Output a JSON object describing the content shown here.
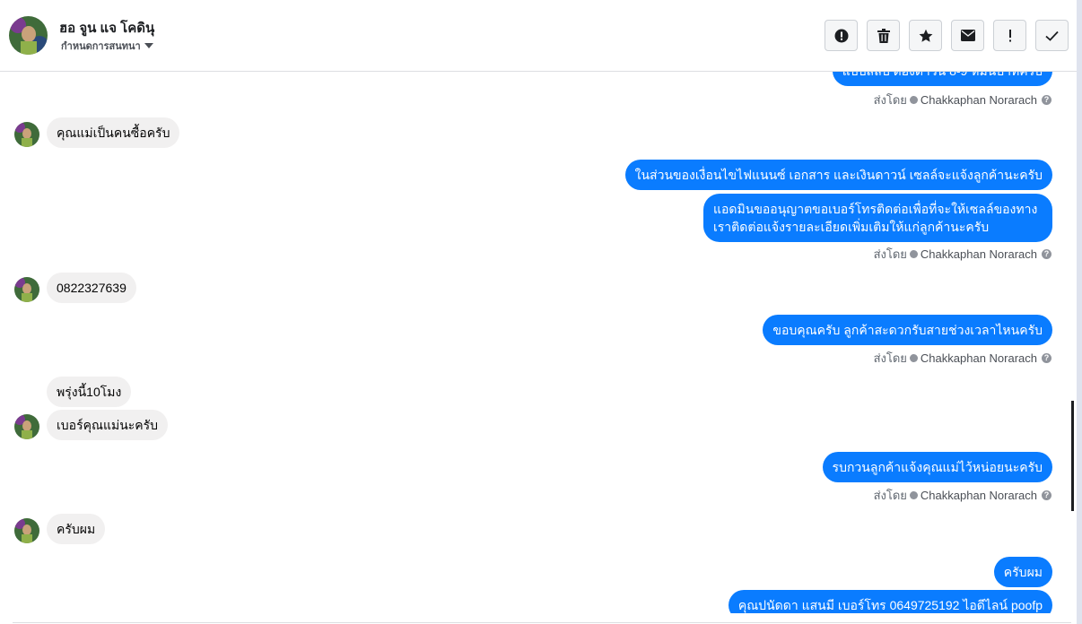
{
  "header": {
    "contact_name": "ฮอ จูน แจ โคดินุ",
    "manage_label": "กำหนดการสนทนา",
    "actions": [
      {
        "name": "report-button",
        "icon": "alert-circle-icon"
      },
      {
        "name": "delete-button",
        "icon": "trash-icon"
      },
      {
        "name": "star-button",
        "icon": "star-icon"
      },
      {
        "name": "mark-unread-button",
        "icon": "envelope-icon"
      },
      {
        "name": "mark-important-button",
        "icon": "exclamation-icon"
      },
      {
        "name": "mark-done-button",
        "icon": "checkmark-icon"
      }
    ]
  },
  "messages": {
    "m0_partial": "แบบสลิป ต้องดำวัน 8-9 หมื่นบาทครับ",
    "sent_by_label": "ส่งโดย",
    "sender_name": "Chakkaphan Norarach",
    "m1": "คุณแม่เป็นคนซื้อครับ",
    "m2": "ในส่วนของเงื่อนไขไฟแนนซ์ เอกสาร และเงินดาวน์ เซลล์จะแจ้งลูกค้านะครับ",
    "m3": "แอดมินขออนุญาตขอเบอร์โทรติดต่อเพื่อที่จะให้เซลล์ของทางเราติดต่อแจ้งรายละเอียดเพิ่มเติมให้แก่ลูกค้านะครับ",
    "m4": "0822327639",
    "m5": "ขอบคุณครับ ลูกค้าสะดวกรับสายช่วงเวลาไหนครับ",
    "m6": "พรุ่งนี้10โมง",
    "m7": "เบอร์คุณแม่นะครับ",
    "m8": "รบกวนลูกค้าแจ้งคุณแม่ไว้หน่อยนะครับ",
    "m9": "ครับผม",
    "m10": "ครับผม",
    "m11_partial": "คุณปนัดดา แสนมี   เบอร์โทร 0649725192  ไอดีไลน์ poofp"
  },
  "colors": {
    "outgoing_bubble": "#0a7cff",
    "incoming_bubble": "#f1f0f0",
    "header_border": "#dddfe2"
  }
}
